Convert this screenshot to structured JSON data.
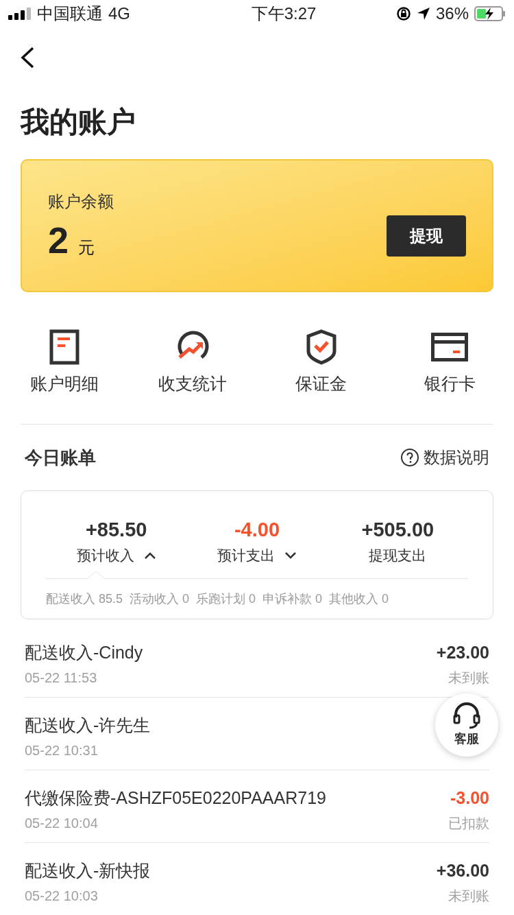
{
  "status_bar": {
    "carrier": "中国联通",
    "network": "4G",
    "time": "下午3:27",
    "battery": "36%"
  },
  "title": "我的账户",
  "balance": {
    "label": "账户余额",
    "amount": "2",
    "unit": "元",
    "button": "提现"
  },
  "shortcuts": [
    {
      "kind": "detail",
      "label": "账户明细"
    },
    {
      "kind": "stats",
      "label": "收支统计"
    },
    {
      "kind": "deposit",
      "label": "保证金"
    },
    {
      "kind": "card",
      "label": "银行卡"
    }
  ],
  "bill": {
    "title": "今日账单",
    "help": "数据说明",
    "summary": [
      {
        "value": "+85.50",
        "label": "预计收入",
        "negative": false,
        "expandable": true,
        "expanded": true
      },
      {
        "value": "-4.00",
        "label": "预计支出",
        "negative": true,
        "expandable": true,
        "expanded": false
      },
      {
        "value": "+505.00",
        "label": "提现支出",
        "negative": false,
        "expandable": false
      }
    ],
    "breakdown": "配送收入 85.5  活动收入 0  乐跑计划 0  申诉补款 0  其他收入 0"
  },
  "transactions": [
    {
      "title": "配送收入-Cindy",
      "time": "05-22 11:53",
      "amount": "+23.00",
      "negative": false,
      "status": "未到账"
    },
    {
      "title": "配送收入-许先生",
      "time": "05-22 10:31"
    },
    {
      "title": "代缴保险费-ASHZF05E0220PAAAR719",
      "time": "05-22 10:04",
      "amount": "-3.00",
      "negative": true,
      "status": "已扣款"
    },
    {
      "title": "配送收入-新快报",
      "time": "05-22 10:03",
      "amount": "+36.00",
      "negative": false,
      "status": "未到账"
    }
  ],
  "float_button": {
    "label": "客服"
  }
}
